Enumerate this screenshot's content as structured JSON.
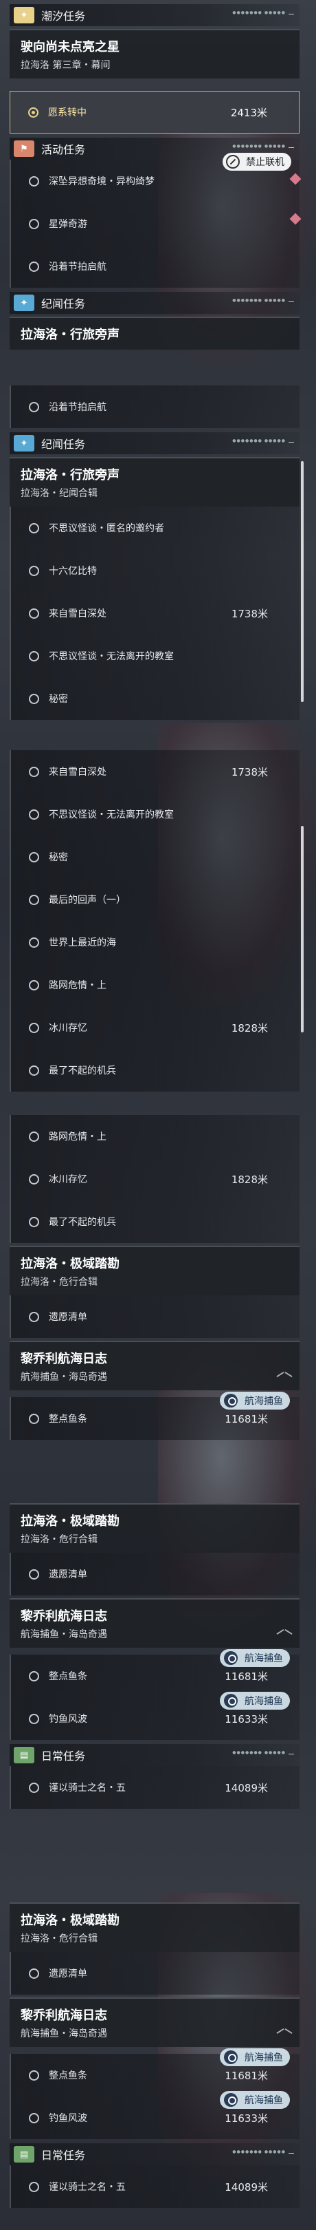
{
  "sections": {
    "tide": "潮汐任务",
    "activity": "活动任务",
    "chronicle": "纪闻任务",
    "daily": "日常任务",
    "tail": "●●●●●●● ●●●●●"
  },
  "status": {
    "ban_coop": "禁止联机"
  },
  "quests": {
    "tide_main": {
      "title": "驶向尚未点亮之星",
      "sub": "拉海洛 第三章・幕间"
    },
    "tide_track": {
      "label": "愿系转中",
      "dist": "2413米"
    },
    "act1": "深坠异想奇境・异构绮梦",
    "act2": "星弹奇游",
    "act3": "沿着节拍启航",
    "ch_title": "拉海洛・行旅旁声",
    "ch_sub": "拉海洛・纪闻合辑",
    "n1": "不思议怪谈・匿名的邀约者",
    "n2": "十六亿比特",
    "n3": "来自雪白深处",
    "n4": "不思议怪谈・无法离开的教室",
    "n5": "秘密",
    "n6": "最后的回声（一）",
    "n7": "世界上最近的海",
    "n8": "路网危情・上",
    "n9": "冰川存忆",
    "n10": "最了不起的机兵",
    "d_snow": "1738米",
    "d_ice": "1828米",
    "polar_title": "拉海洛・极域踏勘",
    "polar_sub": "拉海洛・危行合辑",
    "polar_item": "遗愿清单",
    "log_title": "黎乔利航海日志",
    "log_sub": "航海捕鱼・海岛奇遇",
    "fish1": "整点鱼条",
    "fish1_d": "11681米",
    "fish2": "钓鱼风波",
    "fish2_d": "11633米",
    "fish_tag": "航海捕鱼",
    "daily_item": "谨以骑士之名・五",
    "daily_d": "14089米"
  }
}
